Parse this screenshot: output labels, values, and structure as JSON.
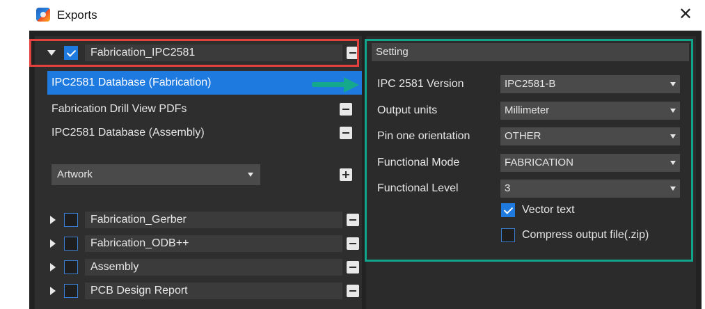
{
  "window": {
    "title": "Exports",
    "app_icon": "app-icon",
    "close_glyph": "✕"
  },
  "colors": {
    "selection_blue": "#1f7ae0",
    "highlight_red": "#e2413d",
    "highlight_teal": "#10a58a"
  },
  "left_panel": {
    "active_group": {
      "label": "Fabrication_IPC2581",
      "checked": true,
      "expanded": true
    },
    "items": [
      {
        "label": "IPC2581 Database (Fabrication)",
        "selected": true
      },
      {
        "label": "Fabrication Drill View PDFs",
        "selected": false
      },
      {
        "label": "IPC2581 Database (Assembly)",
        "selected": false
      }
    ],
    "artwork_select": {
      "value": "Artwork"
    },
    "other_groups": [
      {
        "label": "Fabrication_Gerber",
        "checked": false,
        "expanded": false
      },
      {
        "label": "Fabrication_ODB++",
        "checked": false,
        "expanded": false
      },
      {
        "label": "Assembly",
        "checked": false,
        "expanded": false
      },
      {
        "label": "PCB Design Report",
        "checked": false,
        "expanded": false
      }
    ]
  },
  "setting": {
    "header": "Setting",
    "fields": [
      {
        "label": "IPC 2581 Version",
        "value": "IPC2581-B"
      },
      {
        "label": "Output units",
        "value": "Millimeter"
      },
      {
        "label": "Pin one orientation",
        "value": "OTHER"
      },
      {
        "label": "Functional Mode",
        "value": "FABRICATION"
      },
      {
        "label": "Functional Level",
        "value": "3"
      }
    ],
    "options": [
      {
        "label": "Vector text",
        "checked": true
      },
      {
        "label": "Compress output file(.zip)",
        "checked": false
      }
    ]
  }
}
